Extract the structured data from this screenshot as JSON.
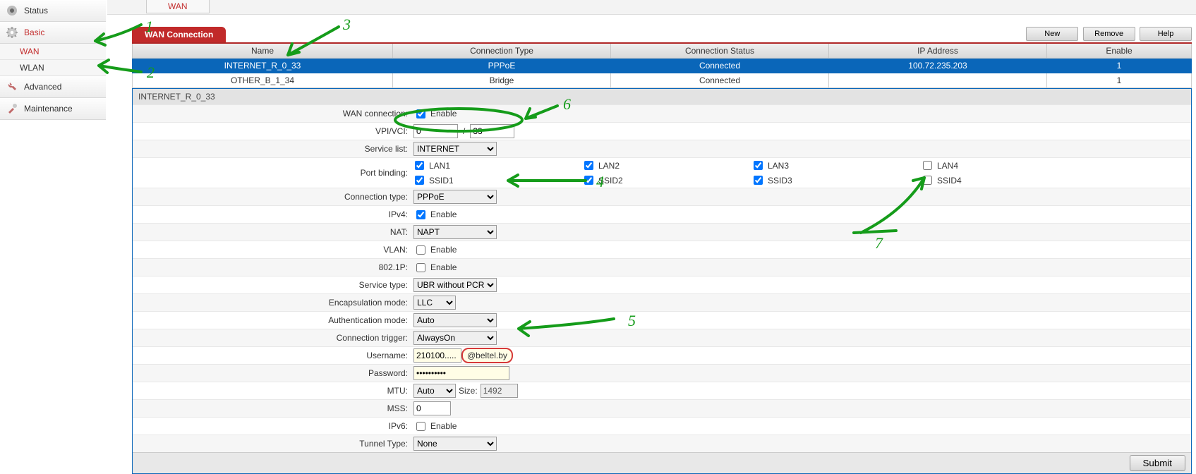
{
  "sidebar": {
    "items": [
      {
        "label": "Status"
      },
      {
        "label": "Basic"
      },
      {
        "label": "Advanced"
      },
      {
        "label": "Maintenance"
      }
    ],
    "basic_sub": [
      {
        "label": "WAN"
      },
      {
        "label": "WLAN"
      }
    ]
  },
  "toptab": "WAN",
  "section_title": "WAN Connection",
  "toolbar": {
    "new": "New",
    "remove": "Remove",
    "help": "Help"
  },
  "table": {
    "headers": {
      "name": "Name",
      "ctype": "Connection Type",
      "cstatus": "Connection Status",
      "ip": "IP Address",
      "enable": "Enable"
    },
    "rows": [
      {
        "name": "INTERNET_R_0_33",
        "ctype": "PPPoE",
        "cstatus": "Connected",
        "ip": "100.72.235.203",
        "enable": "1"
      },
      {
        "name": "OTHER_B_1_34",
        "ctype": "Bridge",
        "cstatus": "Connected",
        "ip": "",
        "enable": "1"
      }
    ]
  },
  "panel_title": "INTERNET_R_0_33",
  "labels": {
    "wanconn": "WAN connection:",
    "vpivci": "VPI/VCI:",
    "servicelist": "Service list:",
    "portbinding": "Port binding:",
    "conntype": "Connection type:",
    "ipv4": "IPv4:",
    "nat": "NAT:",
    "vlan": "VLAN:",
    "p8021": "802.1P:",
    "svctype": "Service type:",
    "encap": "Encapsulation mode:",
    "auth": "Authentication mode:",
    "trigger": "Connection trigger:",
    "username": "Username:",
    "password": "Password:",
    "mtu": "MTU:",
    "mss": "MSS:",
    "ipv6": "IPv6:",
    "tunnel": "Tunnel Type:",
    "enable": "Enable",
    "size": "Size:"
  },
  "values": {
    "vpi": "0",
    "vci": "33",
    "servicelist": "INTERNET",
    "conntype": "PPPoE",
    "nat": "NAPT",
    "svctype": "UBR without PCR",
    "encap": "LLC",
    "auth": "Auto",
    "trigger": "AlwaysOn",
    "username": "210100.....",
    "username_suffix": "@beltel.by",
    "password": "••••••••••",
    "mtu_mode": "Auto",
    "mtu_size": "1492",
    "mss": "0",
    "tunnel": "None"
  },
  "ports": {
    "lan1": "LAN1",
    "lan2": "LAN2",
    "lan3": "LAN3",
    "lan4": "LAN4",
    "ssid1": "SSID1",
    "ssid2": "SSID2",
    "ssid3": "SSID3",
    "ssid4": "SSID4"
  },
  "submit": "Submit",
  "annotations": {
    "n1": "1",
    "n2": "2",
    "n3": "3",
    "n4": "4",
    "n5": "5",
    "n6": "6",
    "n7": "7"
  }
}
